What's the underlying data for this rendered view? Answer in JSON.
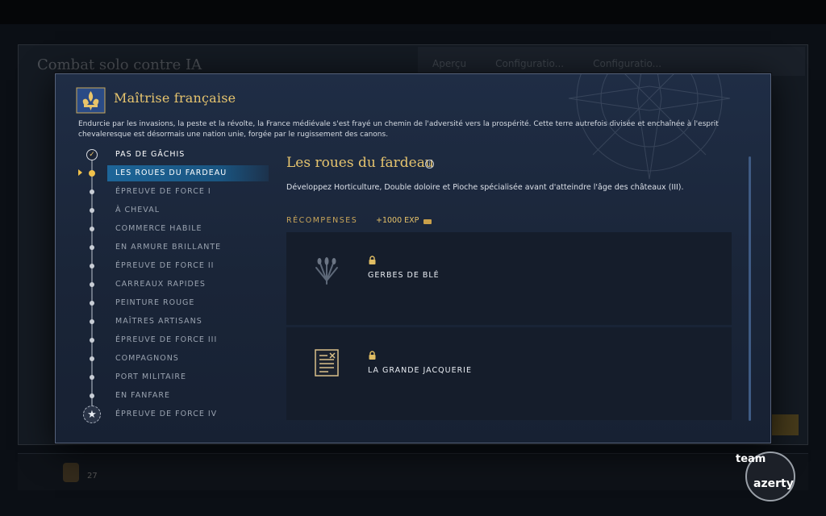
{
  "background": {
    "window_title": "Combat solo contre IA",
    "tabs": [
      "Aperçu",
      "Configuratio...",
      "Configuratio..."
    ],
    "level": "27"
  },
  "modal": {
    "title": "Maîtrise française",
    "description": "Endurcie par les invasions, la peste et la révolte, la France médiévale s'est frayé un chemin de l'adversité vers la prospérité. Cette terre autrefois divisée et enchaînée à l'esprit chevaleresque est désormais une nation unie, forgée par le rugissement des canons.",
    "emblem_icon": "fleur-de-lis-banner-icon"
  },
  "steps": [
    {
      "label": "PAS DE GÂCHIS",
      "state": "done"
    },
    {
      "label": "LES ROUES DU FARDEAU",
      "state": "active"
    },
    {
      "label": "ÉPREUVE DE FORCE I",
      "state": "locked"
    },
    {
      "label": "À CHEVAL",
      "state": "locked"
    },
    {
      "label": "COMMERCE HABILE",
      "state": "locked"
    },
    {
      "label": "EN ARMURE BRILLANTE",
      "state": "locked"
    },
    {
      "label": "ÉPREUVE DE FORCE II",
      "state": "locked"
    },
    {
      "label": "CARREAUX RAPIDES",
      "state": "locked"
    },
    {
      "label": "PEINTURE ROUGE",
      "state": "locked"
    },
    {
      "label": "MAÎTRES ARTISANS",
      "state": "locked"
    },
    {
      "label": "ÉPREUVE DE FORCE III",
      "state": "locked"
    },
    {
      "label": "COMPAGNONS",
      "state": "locked"
    },
    {
      "label": "PORT MILITAIRE",
      "state": "locked"
    },
    {
      "label": "EN FANFARE",
      "state": "locked"
    },
    {
      "label": "ÉPREUVE DE FORCE IV",
      "state": "final"
    }
  ],
  "detail": {
    "title": "Les roues du fardeau",
    "description": "Développez Horticulture, Double doloire et Pioche spécialisée avant d'atteindre l'âge des châteaux (III).",
    "rewards_label": "RÉCOMPENSES",
    "exp": "+1000 EXP",
    "rewards": [
      {
        "name": "GERBES DE BLÉ",
        "icon": "wheat-sheaf-icon",
        "locked": true
      },
      {
        "name": "LA GRANDE JACQUERIE",
        "icon": "document-scroll-icon",
        "locked": true
      }
    ]
  },
  "watermark": {
    "line1": "team",
    "line2": "azerty"
  },
  "colors": {
    "accent_gold": "#e6c46e",
    "active_blue": "#1d6598",
    "panel": "#1f2d45"
  }
}
